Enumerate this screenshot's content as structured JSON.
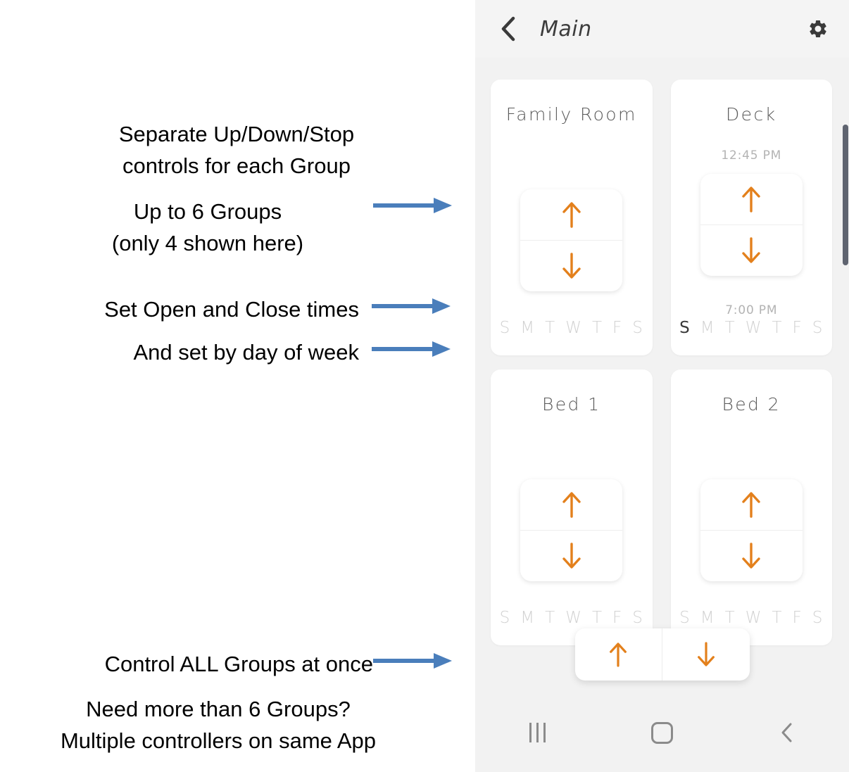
{
  "annotations": [
    {
      "id": "separate-controls",
      "text": "Separate Up/Down/Stop\ncontrols for each Group"
    },
    {
      "id": "up-to-6-groups",
      "text": "Up to 6 Groups\n(only 4 shown here)"
    },
    {
      "id": "set-times",
      "text": "Set Open and Close times"
    },
    {
      "id": "set-day-of-week",
      "text": "And set by day of week"
    },
    {
      "id": "control-all-groups",
      "text": "Control ALL Groups at once"
    },
    {
      "id": "more-than-6-groups",
      "text": "Need more than 6 Groups?\nMultiple controllers on same App"
    }
  ],
  "phone": {
    "header": {
      "title": "Main",
      "back_icon": "chevron-left-icon",
      "settings_icon": "gear-icon"
    },
    "cards": [
      {
        "title": "Family Room",
        "open_time": "",
        "close_time": "",
        "has_times": false,
        "up_icon": "arrow-up-icon",
        "down_icon": "arrow-down-icon",
        "days": [
          {
            "letter": "S",
            "active": false
          },
          {
            "letter": "M",
            "active": false
          },
          {
            "letter": "T",
            "active": false
          },
          {
            "letter": "W",
            "active": false
          },
          {
            "letter": "T",
            "active": false
          },
          {
            "letter": "F",
            "active": false
          },
          {
            "letter": "S",
            "active": false
          }
        ]
      },
      {
        "title": "Deck",
        "open_time": "12:45 PM",
        "close_time": "7:00 PM",
        "has_times": true,
        "up_icon": "arrow-up-icon",
        "down_icon": "arrow-down-icon",
        "days": [
          {
            "letter": "S",
            "active": true
          },
          {
            "letter": "M",
            "active": false
          },
          {
            "letter": "T",
            "active": false
          },
          {
            "letter": "W",
            "active": false
          },
          {
            "letter": "T",
            "active": false
          },
          {
            "letter": "F",
            "active": false
          },
          {
            "letter": "S",
            "active": false
          }
        ]
      },
      {
        "title": "Bed 1",
        "open_time": "",
        "close_time": "",
        "has_times": false,
        "up_icon": "arrow-up-icon",
        "down_icon": "arrow-down-icon",
        "days": [
          {
            "letter": "S",
            "active": false
          },
          {
            "letter": "M",
            "active": false
          },
          {
            "letter": "T",
            "active": false
          },
          {
            "letter": "W",
            "active": false
          },
          {
            "letter": "T",
            "active": false
          },
          {
            "letter": "F",
            "active": false
          },
          {
            "letter": "S",
            "active": false
          }
        ]
      },
      {
        "title": "Bed 2",
        "open_time": "",
        "close_time": "",
        "has_times": false,
        "up_icon": "arrow-up-icon",
        "down_icon": "arrow-down-icon",
        "days": [
          {
            "letter": "S",
            "active": false
          },
          {
            "letter": "M",
            "active": false
          },
          {
            "letter": "T",
            "active": false
          },
          {
            "letter": "W",
            "active": false
          },
          {
            "letter": "T",
            "active": false
          },
          {
            "letter": "F",
            "active": false
          },
          {
            "letter": "S",
            "active": false
          }
        ]
      }
    ],
    "all_control": {
      "up_icon": "arrow-up-icon",
      "down_icon": "arrow-down-icon"
    },
    "navbar": {
      "recents_icon": "recents-icon",
      "home_icon": "home-icon",
      "back_icon": "back-chevron-icon"
    }
  },
  "colors": {
    "accent_orange": "#E3801C",
    "arrow_blue": "#4A7EBB",
    "card_background": "#FFFFFF",
    "panel_background": "#F2F2F2",
    "day_inactive": "#D2D2D2",
    "day_active": "#3A3A3A",
    "scrollbar": "#5F6470"
  }
}
